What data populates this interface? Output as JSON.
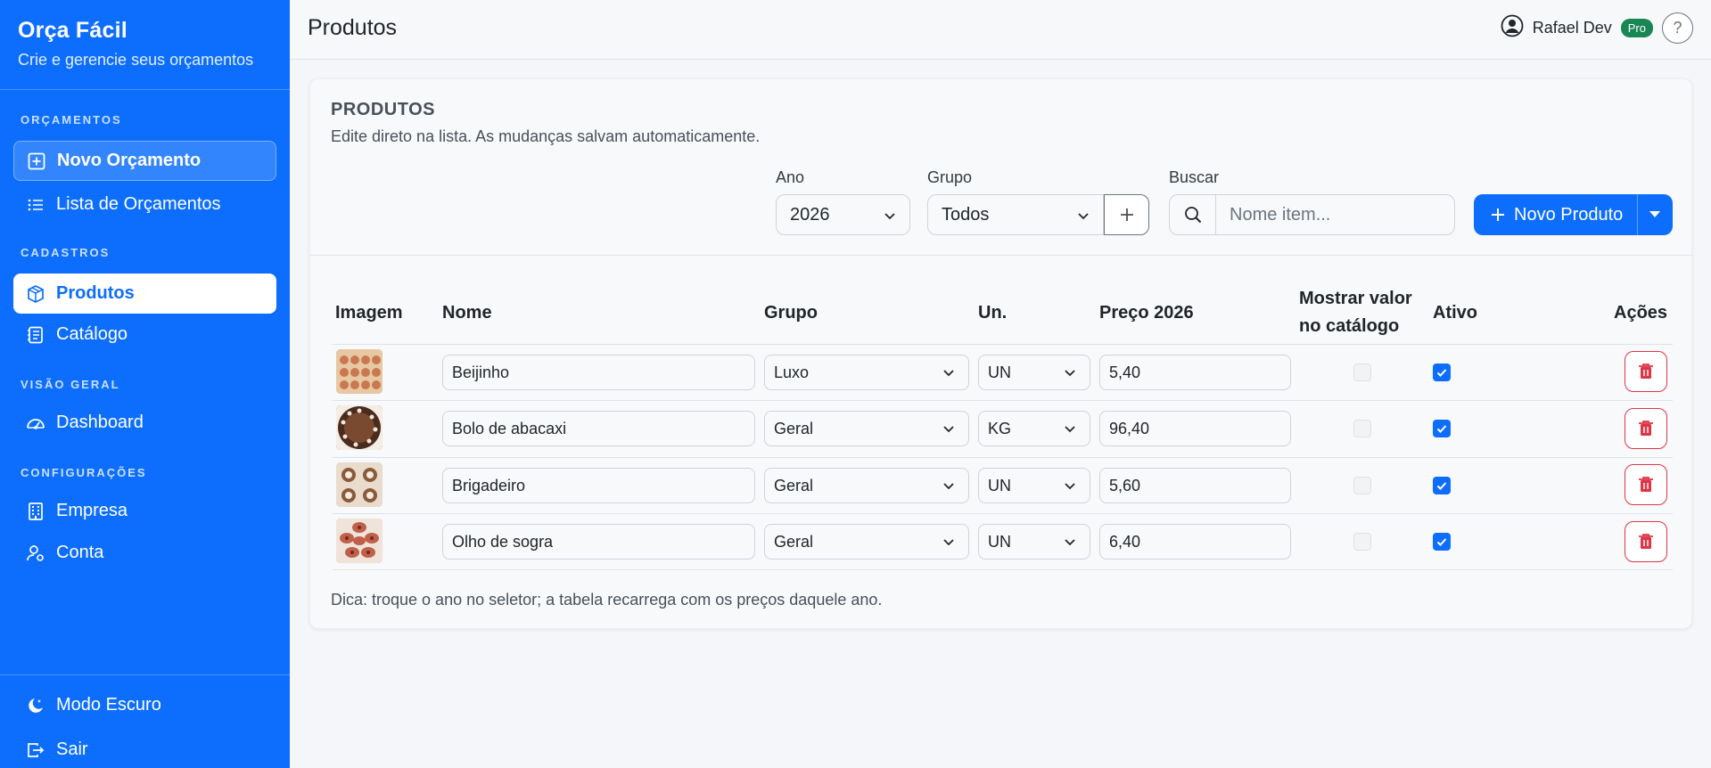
{
  "sidebar": {
    "brand_title": "Orça Fácil",
    "brand_subtitle": "Crie e gerencie seus orçamentos",
    "sections": {
      "orcamentos": "ORÇAMENTOS",
      "cadastros": "CADASTROS",
      "visao_geral": "VISÃO GERAL",
      "configuracoes": "CONFIGURAÇÕES"
    },
    "items": {
      "novo_orcamento": "Novo Orçamento",
      "lista_orcamentos": "Lista de Orçamentos",
      "produtos": "Produtos",
      "catalogo": "Catálogo",
      "dashboard": "Dashboard",
      "empresa": "Empresa",
      "conta": "Conta",
      "modo_escuro": "Modo Escuro",
      "sair": "Sair"
    }
  },
  "header": {
    "title": "Produtos",
    "user_name": "Rafael Dev",
    "plan_badge": "Pro",
    "help": "?"
  },
  "card": {
    "title": "PRODUTOS",
    "description": "Edite direto na lista. As mudanças salvam automaticamente.",
    "filters": {
      "ano_label": "Ano",
      "ano_value": "2026",
      "grupo_label": "Grupo",
      "grupo_value": "Todos",
      "buscar_label": "Buscar",
      "buscar_placeholder": "Nome item..."
    },
    "new_button": "Novo Produto",
    "hint": "Dica: troque o ano no seletor; a tabela recarrega com os preços daquele ano."
  },
  "table": {
    "headers": {
      "imagem": "Imagem",
      "nome": "Nome",
      "grupo": "Grupo",
      "un": "Un.",
      "preco": "Preço 2026",
      "mostrar_1": "Mostrar valor",
      "mostrar_2": "no catálogo",
      "ativo": "Ativo",
      "acoes": "Ações"
    },
    "rows": [
      {
        "nome": "Beijinho",
        "grupo": "Luxo",
        "un": "UN",
        "preco": "5,40",
        "mostrar": false,
        "ativo": true,
        "thumb": "#d9a37a"
      },
      {
        "nome": "Bolo de abacaxi",
        "grupo": "Geral",
        "un": "KG",
        "preco": "96,40",
        "mostrar": false,
        "ativo": true,
        "thumb": "#5a3524"
      },
      {
        "nome": "Brigadeiro",
        "grupo": "Geral",
        "un": "UN",
        "preco": "5,60",
        "mostrar": false,
        "ativo": true,
        "thumb": "#c8a685"
      },
      {
        "nome": "Olho de sogra",
        "grupo": "Geral",
        "un": "UN",
        "preco": "6,40",
        "mostrar": false,
        "ativo": true,
        "thumb": "#b8705a"
      }
    ]
  },
  "colors": {
    "primary": "#0d6efd",
    "danger": "#dc3545",
    "success": "#198754"
  }
}
